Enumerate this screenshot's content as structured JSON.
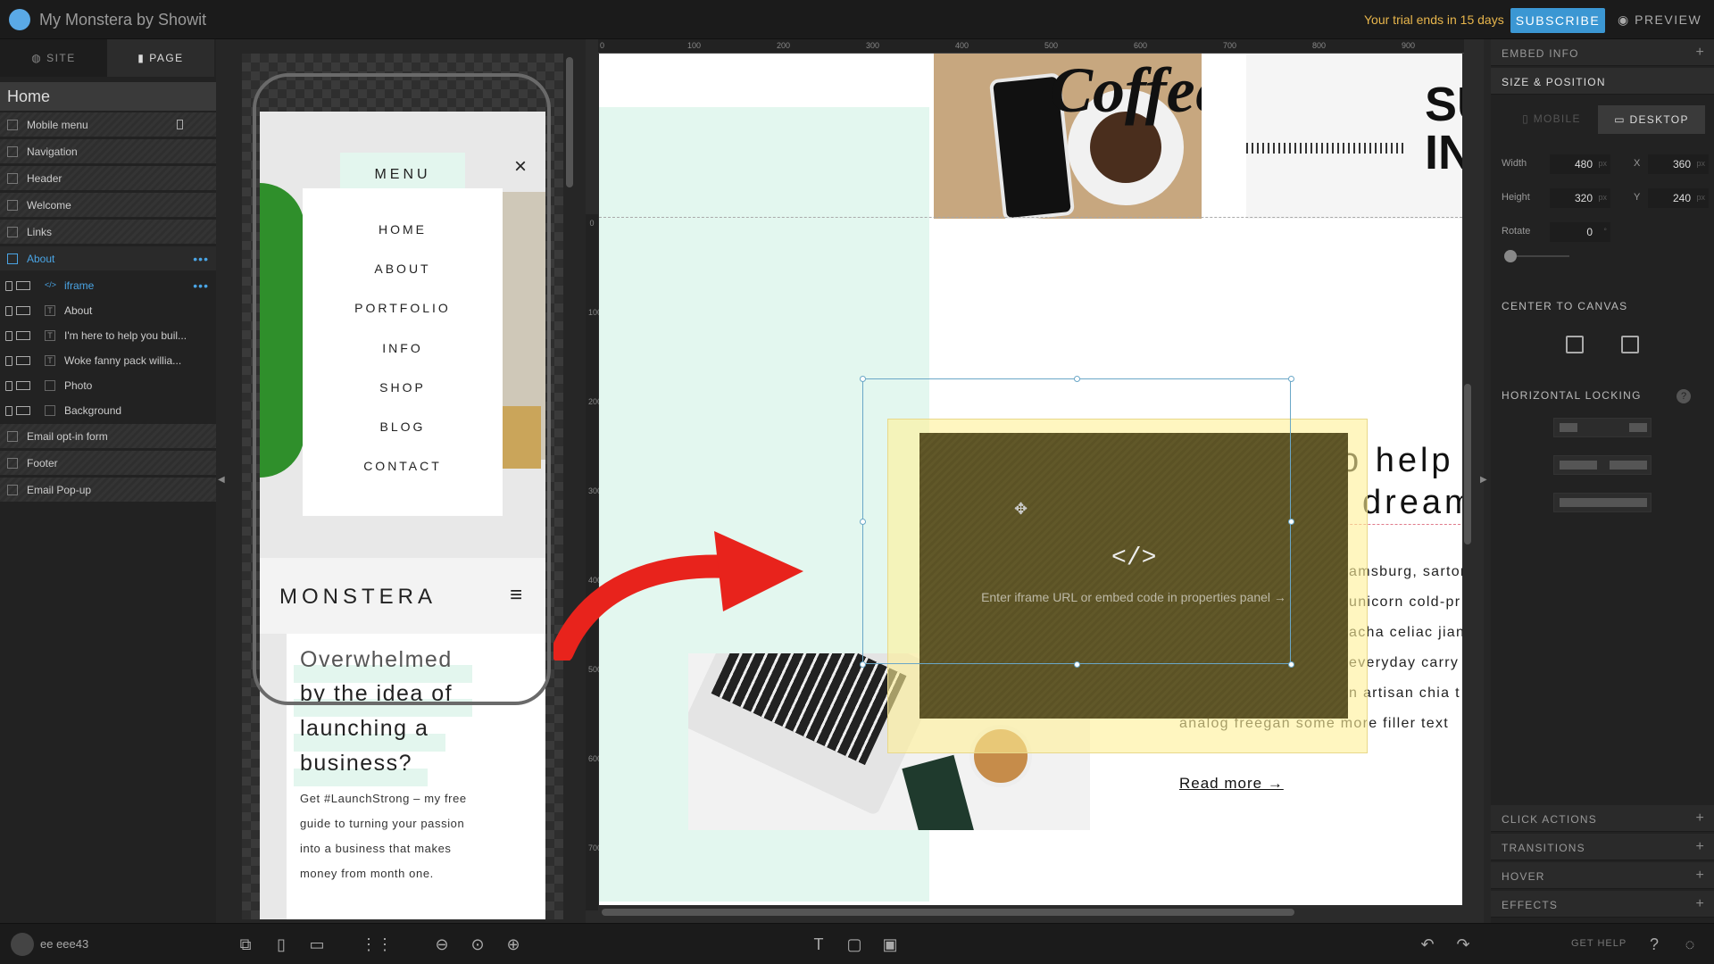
{
  "app": {
    "title": "My Monstera by Showit",
    "trial_text": "Your trial ends in 15 days",
    "subscribe": "SUBSCRIBE",
    "preview": "PREVIEW"
  },
  "left_panel": {
    "tabs": {
      "site": "SITE",
      "page": "PAGE"
    },
    "page_title": "Home",
    "sections": [
      "Mobile menu",
      "Navigation",
      "Header",
      "Welcome",
      "Links",
      "About"
    ],
    "about_children": [
      "iframe",
      "About",
      "I'm here to help you buil...",
      "Woke fanny pack willia...",
      "Photo",
      "Background"
    ],
    "sections_after": [
      "Email opt-in form",
      "Footer",
      "Email Pop-up"
    ]
  },
  "mobile_preview": {
    "menu_label": "MENU",
    "close": "×",
    "menu_items": [
      "HOME",
      "ABOUT",
      "PORTFOLIO",
      "INFO",
      "SHOP",
      "BLOG",
      "CONTACT"
    ],
    "brand": "MONSTERA",
    "burger": "≡",
    "headline": [
      "Overwhelmed",
      "by the idea of",
      "launching a",
      "business?"
    ],
    "body": [
      "Get #LaunchStrong – my free",
      "guide to turning your passion",
      "into a business that makes",
      "money from month one."
    ]
  },
  "ruler": {
    "top": [
      "0",
      "100",
      "200",
      "300",
      "400",
      "500",
      "600",
      "700",
      "800",
      "900"
    ],
    "left": [
      "0",
      "100",
      "200",
      "300",
      "400",
      "500",
      "600",
      "700"
    ]
  },
  "canvas": {
    "coffee_word": "Coffee",
    "notebook_text": "SU IN",
    "heading": [
      "o help y",
      "dream"
    ],
    "body_lines": [
      "amsburg, sartor",
      "unicorn cold-pr",
      "acha celiac jian",
      "everyday carry p",
      "n artisan chia t",
      "analog freegan some more filler text"
    ],
    "read_more": "Read more →",
    "embed_icon": "</>",
    "embed_hint": "Enter iframe URL or embed code in properties panel →",
    "move_icon": "✥"
  },
  "right_panel": {
    "embed_info": "EMBED INFO",
    "size_position": "SIZE & POSITION",
    "tab_mobile": "MOBILE",
    "tab_desktop": "DESKTOP",
    "width_label": "Width",
    "width": "480",
    "height_label": "Height",
    "height": "320",
    "x_label": "X",
    "x": "360",
    "y_label": "Y",
    "y": "240",
    "rotate_label": "Rotate",
    "rotate": "0",
    "unit": "px",
    "center_to_canvas": "CENTER TO CANVAS",
    "horizontal_locking": "HORIZONTAL LOCKING",
    "help_q": "?",
    "bottom_sections": [
      "CLICK ACTIONS",
      "TRANSITIONS",
      "HOVER",
      "EFFECTS"
    ]
  },
  "bottom_bar": {
    "username": "ee eee43",
    "get_help": "GET HELP"
  },
  "colors": {
    "accent": "#3b97d3",
    "trial": "#e8b64c",
    "mint": "#e3f7ef",
    "selection": "#4aa4e4",
    "arrow": "#e8231c"
  }
}
